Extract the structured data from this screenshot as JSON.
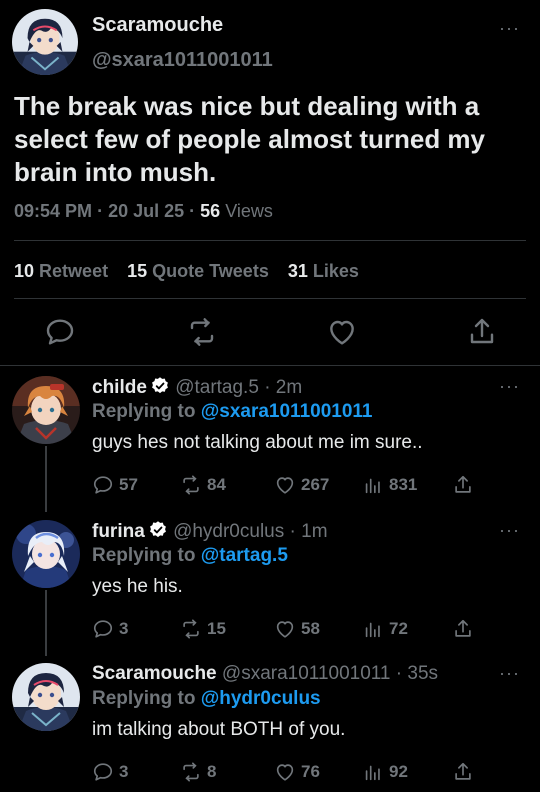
{
  "main_tweet": {
    "name": "Scaramouche",
    "handle": "@sxara1011001011",
    "more": "···",
    "text": "The break was nice but dealing with a select few of people almost turned my brain into mush.",
    "time": "09:54 PM",
    "date": "20 Jul 25",
    "views_count": "56",
    "views_label": "Views",
    "retweets_count": "10",
    "retweets_label": "Retweet",
    "quotes_count": "15",
    "quotes_label": "Quote Tweets",
    "likes_count": "31",
    "likes_label": "Likes"
  },
  "replies": [
    {
      "name": "childe",
      "handle": "@tartag.5",
      "time": "2m",
      "replying_prefix": "Replying to",
      "replying_to": "@sxara1011001011",
      "text": "guys hes not talking about me im sure..",
      "replies": "57",
      "retweets": "84",
      "likes": "267",
      "views": "831",
      "verified": true
    },
    {
      "name": "furina",
      "handle": "@hydr0culus",
      "time": "1m",
      "replying_prefix": "Replying to",
      "replying_to": "@tartag.5",
      "text": "yes he his.",
      "replies": "3",
      "retweets": "15",
      "likes": "58",
      "views": "72",
      "verified": true
    },
    {
      "name": "Scaramouche",
      "handle": "@sxara1011001011",
      "time": "35s",
      "replying_prefix": "Replying to",
      "replying_to": "@hydr0culus",
      "text": "im talking about BOTH of you.",
      "replies": "3",
      "retweets": "8",
      "likes": "76",
      "views": "92",
      "verified": false
    }
  ],
  "colors": {
    "background": "#000000",
    "text": "#e7e9ea",
    "muted": "#71767b",
    "link": "#1d9bf0",
    "verified": "#ffffff"
  },
  "icons": {
    "reply": "reply-icon",
    "retweet": "retweet-icon",
    "like": "heart-icon",
    "share": "share-icon",
    "views": "views-icon",
    "verified": "verified-badge-icon",
    "more": "more-icon"
  }
}
